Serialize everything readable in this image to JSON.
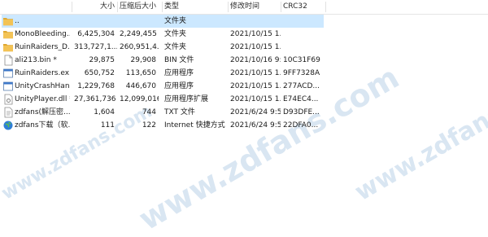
{
  "columns": {
    "name": "",
    "size": "大小",
    "packed": "压缩后大小",
    "type": "类型",
    "modified": "修改时间",
    "crc": "CRC32"
  },
  "rows": [
    {
      "icon": "folder-icon",
      "name": "..",
      "size": "",
      "packed": "",
      "type": "文件夹",
      "modified": "",
      "crc": "",
      "selected": true
    },
    {
      "icon": "folder-icon",
      "name": "MonoBleeding...",
      "size": "6,425,304",
      "packed": "2,249,455",
      "type": "文件夹",
      "modified": "2021/10/15 1...",
      "crc": ""
    },
    {
      "icon": "folder-icon",
      "name": "RuinRaiders_D...",
      "size": "313,727,1...",
      "packed": "260,951,4...",
      "type": "文件夹",
      "modified": "2021/10/15 1...",
      "crc": ""
    },
    {
      "icon": "file-icon",
      "name": "ali213.bin *",
      "size": "29,875",
      "packed": "29,908",
      "type": "BIN 文件",
      "modified": "2021/10/16 9:...",
      "crc": "10C31F69"
    },
    {
      "icon": "exe-icon",
      "name": "RuinRaiders.ex...",
      "size": "650,752",
      "packed": "113,650",
      "type": "应用程序",
      "modified": "2021/10/15 1...",
      "crc": "9FF7328A"
    },
    {
      "icon": "exe-icon",
      "name": "UnityCrashHan...",
      "size": "1,229,768",
      "packed": "446,670",
      "type": "应用程序",
      "modified": "2021/10/15 1...",
      "crc": "277ACD..."
    },
    {
      "icon": "dll-icon",
      "name": "UnityPlayer.dll *",
      "size": "27,361,736",
      "packed": "12,099,016",
      "type": "应用程序扩展",
      "modified": "2021/10/15 1...",
      "crc": "E74EC4..."
    },
    {
      "icon": "txt-icon",
      "name": "zdfans(解压密...",
      "size": "1,604",
      "packed": "744",
      "type": "TXT 文件",
      "modified": "2021/6/24 9:5...",
      "crc": "D93DFE..."
    },
    {
      "icon": "globe-icon",
      "name": "zdfans下载（软...",
      "size": "111",
      "packed": "122",
      "type": "Internet 快捷方式",
      "modified": "2021/6/24 9:5...",
      "crc": "22DFA0..."
    }
  ],
  "watermark": "www.zdfans.com",
  "colors": {
    "selection": "#cce8ff",
    "folder": "#f3c355",
    "folder_dark": "#dfa832"
  }
}
